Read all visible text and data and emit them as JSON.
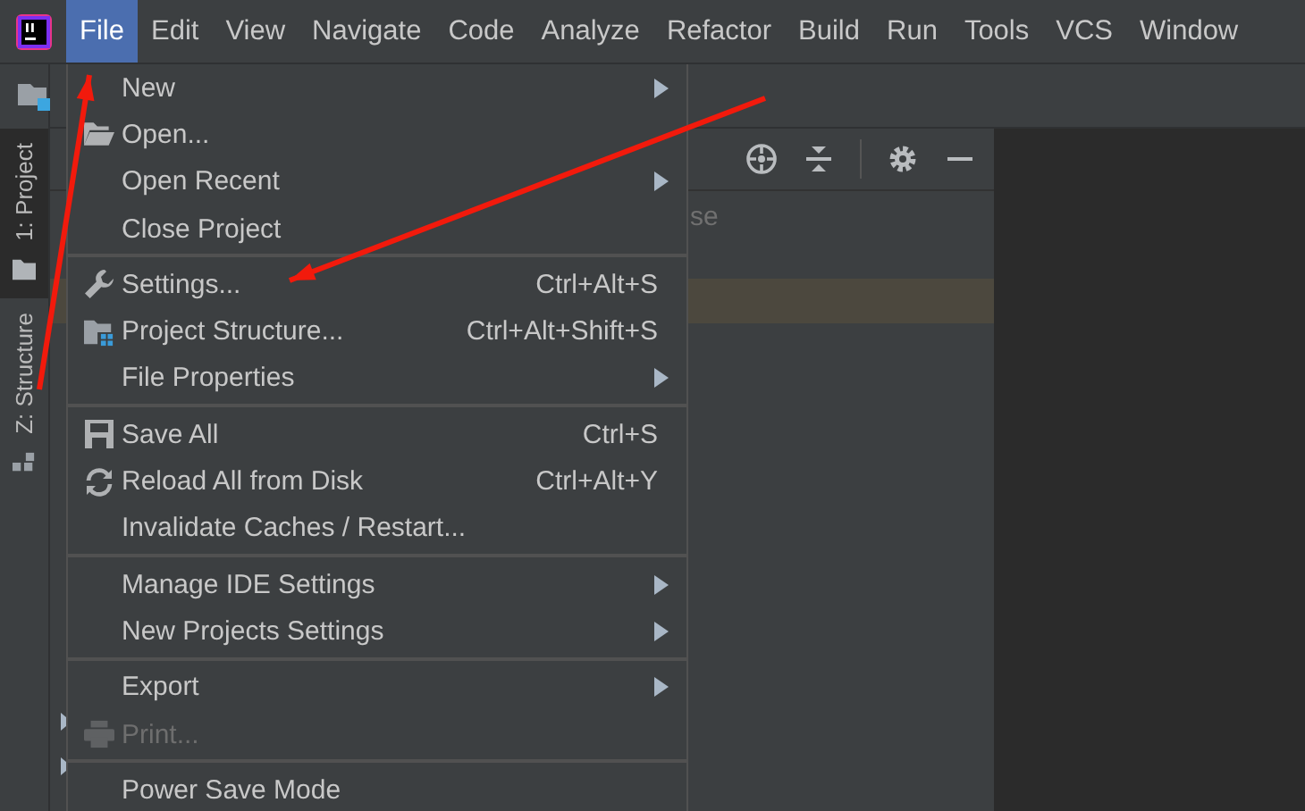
{
  "menubar": [
    {
      "label": "File",
      "selected": true
    },
    {
      "label": "Edit",
      "selected": false
    },
    {
      "label": "View",
      "selected": false
    },
    {
      "label": "Navigate",
      "selected": false
    },
    {
      "label": "Code",
      "selected": false
    },
    {
      "label": "Analyze",
      "selected": false
    },
    {
      "label": "Refactor",
      "selected": false
    },
    {
      "label": "Build",
      "selected": false
    },
    {
      "label": "Run",
      "selected": false
    },
    {
      "label": "Tools",
      "selected": false
    },
    {
      "label": "VCS",
      "selected": false
    },
    {
      "label": "Window",
      "selected": false
    }
  ],
  "tool_strip": [
    {
      "label": "1: Project",
      "selected": true,
      "kind": "project"
    },
    {
      "label": "Z: Structure",
      "selected": false,
      "kind": "structure"
    }
  ],
  "project_panel": {
    "hint_fragment": "se"
  },
  "file_menu": {
    "groups": [
      [
        {
          "label": "New",
          "kind": "plain",
          "submenu": true,
          "disabled": false
        },
        {
          "label": "Open...",
          "kind": "open",
          "submenu": false,
          "disabled": false
        },
        {
          "label": "Open Recent",
          "kind": "plain",
          "submenu": true,
          "disabled": false
        },
        {
          "label": "Close Project",
          "kind": "plain",
          "submenu": false,
          "disabled": false
        }
      ],
      [
        {
          "label": "Settings...",
          "kind": "settings",
          "shortcut": "Ctrl+Alt+S",
          "submenu": false,
          "disabled": false
        },
        {
          "label": "Project Structure...",
          "kind": "structure",
          "shortcut": "Ctrl+Alt+Shift+S",
          "submenu": false,
          "disabled": false
        },
        {
          "label": "File Properties",
          "kind": "plain",
          "submenu": true,
          "disabled": false
        }
      ],
      [
        {
          "label": "Save All",
          "kind": "save",
          "shortcut": "Ctrl+S",
          "submenu": false,
          "disabled": false
        },
        {
          "label": "Reload All from Disk",
          "kind": "reload",
          "shortcut": "Ctrl+Alt+Y",
          "submenu": false,
          "disabled": false
        },
        {
          "label": "Invalidate Caches / Restart...",
          "kind": "plain",
          "submenu": false,
          "disabled": false
        }
      ],
      [
        {
          "label": "Manage IDE Settings",
          "kind": "plain",
          "submenu": true,
          "disabled": false
        },
        {
          "label": "New Projects Settings",
          "kind": "plain",
          "submenu": true,
          "disabled": false
        }
      ],
      [
        {
          "label": "Export",
          "kind": "plain",
          "submenu": true,
          "disabled": false
        },
        {
          "label": "Print...",
          "kind": "print",
          "submenu": false,
          "disabled": true
        }
      ],
      [
        {
          "label": "Power Save Mode",
          "kind": "plain",
          "submenu": false,
          "disabled": false
        }
      ]
    ]
  },
  "annotation_arrows": [
    {
      "kind": "arrow"
    },
    {
      "kind": "arrow"
    }
  ]
}
